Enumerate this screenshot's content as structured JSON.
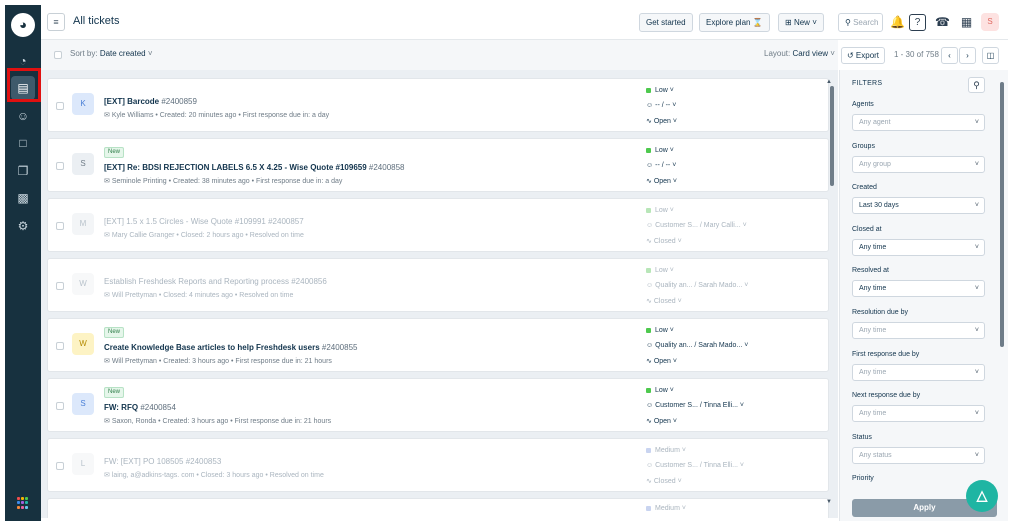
{
  "topbar": {
    "title": "All tickets",
    "get_started": "Get started",
    "explore_plan": "Explore plan",
    "new_label": "New",
    "search_label": "Search",
    "avatar": "S"
  },
  "subbar": {
    "sort_prefix": "Sort by:",
    "sort_value": "Date created",
    "layout_prefix": "Layout:",
    "layout_value": "Card view",
    "export_label": "Export",
    "pagination": "1 - 30 of 758"
  },
  "tickets": [
    {
      "new": "",
      "subject": "[EXT] Barcode",
      "number": "#2400859",
      "requester": "Kyle Williams",
      "meta": "Created: 20 minutes ago • First response due in: a day",
      "priority": "Low",
      "assign": "-- / --",
      "status": "Open",
      "avatar": "K",
      "avatar_bg": "#dce8fb",
      "avatar_fg": "#4a7fd6",
      "priority_color": "#4ec94e",
      "dim": false
    },
    {
      "new": "New",
      "subject": "[EXT] Re: BDSI REJECTION LABELS 6.5 X 4.25 - Wise Quote #109659",
      "number": "#2400858",
      "requester": "Seminole Printing",
      "meta": "Created: 38 minutes ago • First response due in: a day",
      "priority": "Low",
      "assign": "-- / --",
      "status": "Open",
      "avatar": "S",
      "avatar_bg": "#ebeff3",
      "avatar_fg": "#6f7c87",
      "priority_color": "#4ec94e",
      "dim": false
    },
    {
      "new": "",
      "subject": "[EXT] 1.5 x 1.5 Circles - Wise Quote #109991",
      "number": "#2400857",
      "requester": "Mary Callie Granger",
      "meta": "Closed: 2 hours ago • Resolved on time",
      "priority": "Low",
      "assign": "Customer S... / Mary Calli...",
      "status": "Closed",
      "avatar": "M",
      "avatar_bg": "#f3f5f7",
      "avatar_fg": "#b9c3cc",
      "priority_color": "#b8e6b8",
      "dim": true
    },
    {
      "new": "",
      "subject": "Establish Freshdesk Reports and Reporting process",
      "number": "#2400856",
      "requester": "Will Prettyman",
      "meta": "Closed: 4 minutes ago • Resolved on time",
      "priority": "Low",
      "assign": "Quality an... / Sarah Mado...",
      "status": "Closed",
      "avatar": "W",
      "avatar_bg": "#f7f8f9",
      "avatar_fg": "#b9c3cc",
      "priority_color": "#b8e6b8",
      "dim": true
    },
    {
      "new": "New",
      "subject": "Create Knowledge Base articles to help Freshdesk users",
      "number": "#2400855",
      "requester": "Will Prettyman",
      "meta": "Created: 3 hours ago • First response due in: 21 hours",
      "priority": "Low",
      "assign": "Quality an... / Sarah Mado...",
      "status": "Open",
      "avatar": "W",
      "avatar_bg": "#fdf3c4",
      "avatar_fg": "#b38a00",
      "priority_color": "#4ec94e",
      "dim": false
    },
    {
      "new": "New",
      "subject": "FW: RFQ",
      "number": "#2400854",
      "requester": "Saxon, Ronda",
      "meta": "Created: 3 hours ago • First response due in: 21 hours",
      "priority": "Low",
      "assign": "Customer S... / Tinna Elli...",
      "status": "Open",
      "avatar": "S",
      "avatar_bg": "#dce8fb",
      "avatar_fg": "#4a7fd6",
      "priority_color": "#4ec94e",
      "dim": false
    },
    {
      "new": "",
      "subject": "FW: [EXT] PO 108505",
      "number": "#2400853",
      "requester": "laing, a@adkins-tags. com",
      "meta": "Closed: 3 hours ago • Resolved on time",
      "priority": "Medium",
      "assign": "Customer S... / Tinna Elli...",
      "status": "Closed",
      "avatar": "L",
      "avatar_bg": "#f7f8f9",
      "avatar_fg": "#b9c3cc",
      "priority_color": "#c9d4f0",
      "dim": true
    },
    {
      "new": "",
      "subject": "",
      "number": "",
      "requester": "",
      "meta": "",
      "priority": "Medium",
      "assign": "",
      "status": "",
      "avatar": "",
      "avatar_bg": "#f7f8f9",
      "avatar_fg": "#b9c3cc",
      "priority_color": "#c9d4f0",
      "dim": true
    }
  ],
  "filters": {
    "title": "FILTERS",
    "apply_label": "Apply",
    "fields": [
      {
        "label": "Agents",
        "value": "Any agent",
        "set": false
      },
      {
        "label": "Groups",
        "value": "Any group",
        "set": false
      },
      {
        "label": "Created",
        "value": "Last 30 days",
        "set": true
      },
      {
        "label": "Closed at",
        "value": "Any time",
        "set": true
      },
      {
        "label": "Resolved at",
        "value": "Any time",
        "set": true
      },
      {
        "label": "Resolution due by",
        "value": "Any time",
        "set": false
      },
      {
        "label": "First response due by",
        "value": "Any time",
        "set": false
      },
      {
        "label": "Next response due by",
        "value": "Any time",
        "set": false
      },
      {
        "label": "Status",
        "value": "Any status",
        "set": false
      },
      {
        "label": "Priority",
        "value": "",
        "set": false
      }
    ]
  },
  "colors": {
    "rail": "#17313f",
    "highlight": "#e01010",
    "accent": "#1fb5a3"
  }
}
